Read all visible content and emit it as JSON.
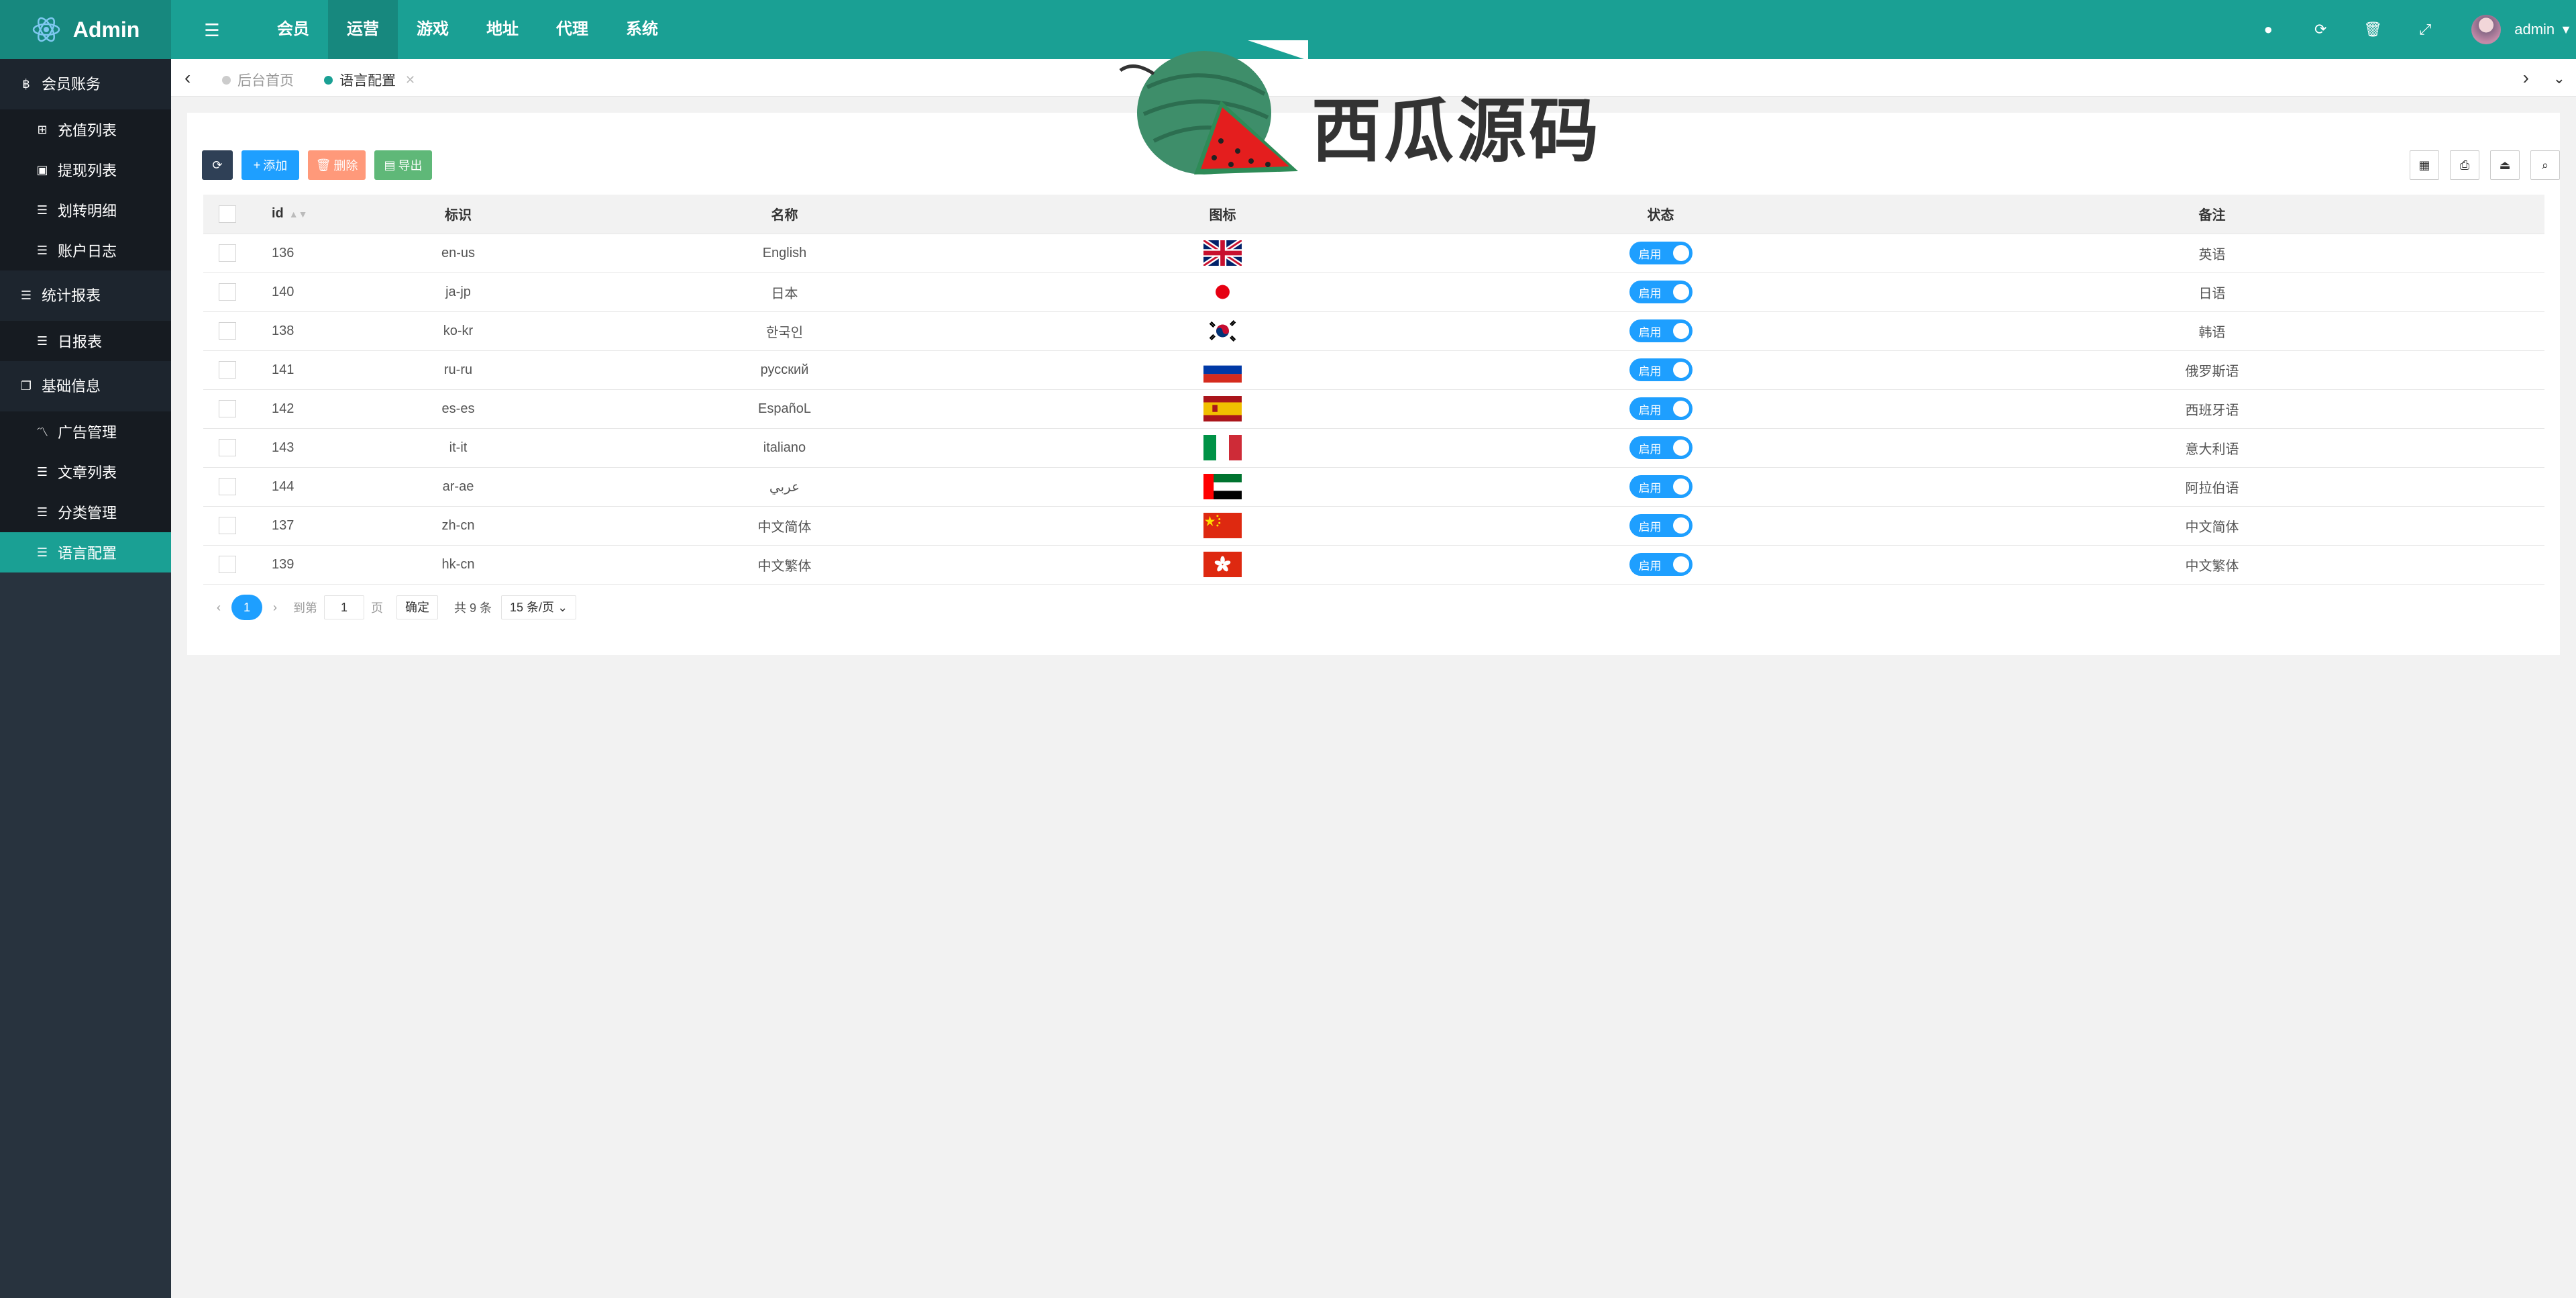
{
  "app": {
    "title": "Admin"
  },
  "topnav": [
    "会员",
    "运营",
    "游戏",
    "地址",
    "代理",
    "系统"
  ],
  "user": {
    "name": "admin"
  },
  "sidebar": {
    "g1": "会员账务",
    "g1_items": [
      "充值列表",
      "提现列表",
      "划转明细",
      "账户日志"
    ],
    "g2": "统计报表",
    "g2_items": [
      "日报表"
    ],
    "g3": "基础信息",
    "g3_items": [
      "广告管理",
      "文章列表",
      "分类管理",
      "语言配置"
    ]
  },
  "tabs": {
    "home": "后台首页",
    "current": "语言配置"
  },
  "toolbar": {
    "add": "添加",
    "delete": "删除",
    "export": "导出"
  },
  "table": {
    "headers": [
      "id",
      "标识",
      "名称",
      "图标",
      "状态",
      "备注"
    ],
    "rows": [
      {
        "id": "136",
        "code": "en-us",
        "name": "English",
        "status": "启用",
        "note": "英语",
        "flag": "uk-flag"
      },
      {
        "id": "140",
        "code": "ja-jp",
        "name": "日本",
        "status": "启用",
        "note": "日语",
        "flag": "japan-flag"
      },
      {
        "id": "138",
        "code": "ko-kr",
        "name": "한국인",
        "status": "启用",
        "note": "韩语",
        "flag": "korea-flag"
      },
      {
        "id": "141",
        "code": "ru-ru",
        "name": "русский",
        "status": "启用",
        "note": "俄罗斯语",
        "flag": "russia-flag"
      },
      {
        "id": "142",
        "code": "es-es",
        "name": "EspañoL",
        "status": "启用",
        "note": "西班牙语",
        "flag": "spain-flag"
      },
      {
        "id": "143",
        "code": "it-it",
        "name": "italiano",
        "status": "启用",
        "note": "意大利语",
        "flag": "italy-flag"
      },
      {
        "id": "144",
        "code": "ar-ae",
        "name": "عربي",
        "status": "启用",
        "note": "阿拉伯语",
        "flag": "uae-flag"
      },
      {
        "id": "137",
        "code": "zh-cn",
        "name": "中文简体",
        "status": "启用",
        "note": "中文简体",
        "flag": "china-flag"
      },
      {
        "id": "139",
        "code": "hk-cn",
        "name": "中文繁体",
        "status": "启用",
        "note": "中文繁体",
        "flag": "hongkong-flag"
      }
    ]
  },
  "pager": {
    "current": "1",
    "goto": "到第",
    "page_value": "1",
    "page_unit": "页",
    "confirm": "确定",
    "total": "共 9 条",
    "per_page": "15 条/页"
  },
  "watermark": {
    "text": "西瓜源码"
  },
  "colors": {
    "primary": "#1aa094",
    "blue": "#1e9fff",
    "sidebar": "#28333e"
  }
}
